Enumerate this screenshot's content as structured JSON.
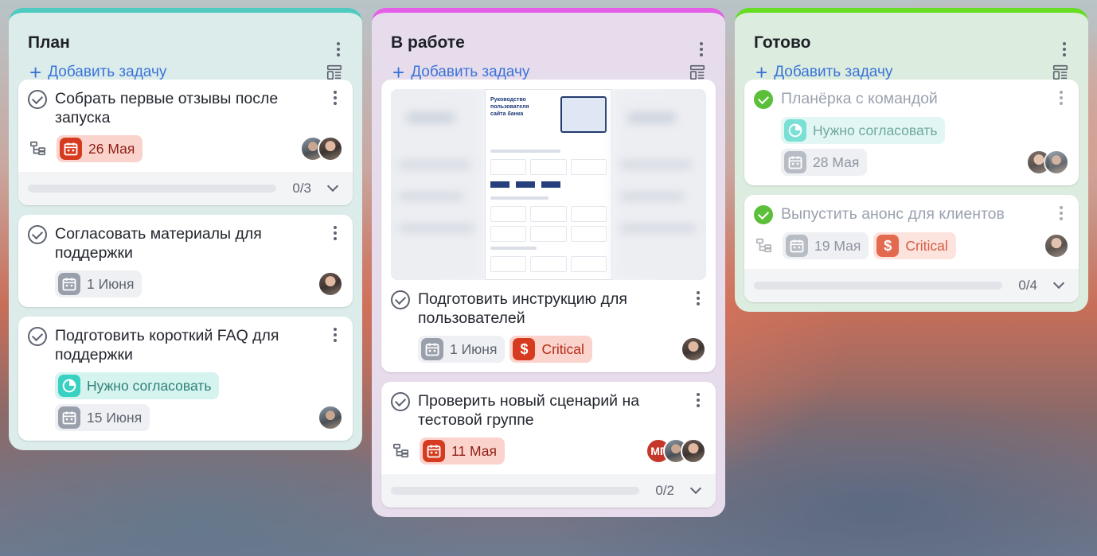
{
  "columns": [
    {
      "title": "План",
      "add_label": "Добавить задачу",
      "cards": [
        {
          "title": "Собрать первые отзывы после запуска",
          "date": "26 Мая",
          "progress": "0/3"
        },
        {
          "title": "Согласовать материалы для поддержки",
          "date": "1 Июня"
        },
        {
          "title": "Подготовить короткий FAQ для поддержки",
          "status": "Нужно согласовать",
          "date": "15 Июня"
        }
      ]
    },
    {
      "title": "В работе",
      "add_label": "Добавить задачу",
      "cards": [
        {
          "title": "Подготовить инструкцию для пользователей",
          "date": "1 Июня",
          "priority": "Critical",
          "cover": {
            "heading": "Руководство пользователя сайта банка"
          }
        },
        {
          "title": "Проверить новый сценарий на тестовой группе",
          "date": "11 Мая",
          "avatar_initials": "МГ",
          "progress": "0/2"
        }
      ]
    },
    {
      "title": "Готово",
      "add_label": "Добавить задачу",
      "cards": [
        {
          "title": "Планёрка с командой",
          "status": "Нужно согласовать",
          "date": "28 Мая"
        },
        {
          "title": "Выпустить анонс для клиентов",
          "date": "19 Мая",
          "priority": "Critical",
          "progress": "0/4"
        }
      ]
    }
  ],
  "icons": {
    "add": "plus-icon",
    "layout": "layout-icon",
    "menu": "more-vertical-icon",
    "calendar": "calendar-icon",
    "priority": "dollar-icon",
    "status": "pie-clock-icon",
    "subtasks": "subtasks-icon",
    "expand": "chevron-down-icon"
  },
  "colors": {
    "plan_accent": "#4ecac0",
    "work_accent": "#e55ee8",
    "done_accent": "#66dd22",
    "link": "#3a73d9",
    "overdue": "#d63b1f",
    "status_teal": "#39d1c2",
    "done_check": "#5cbf3a"
  }
}
